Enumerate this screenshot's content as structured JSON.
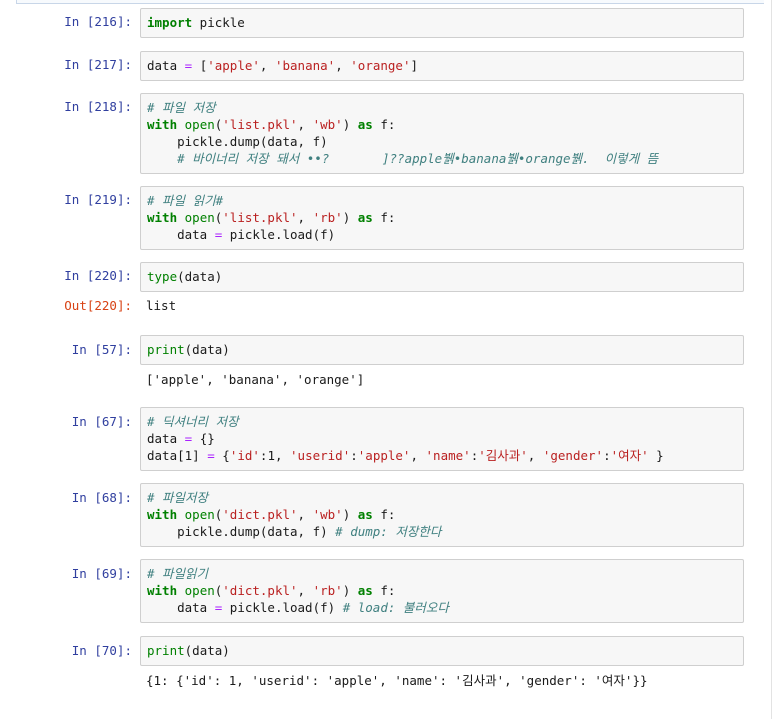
{
  "cells": [
    {
      "prompt": "In [216]:",
      "lines": [
        [
          "kw",
          "import"
        ],
        [
          "plain",
          " pickle"
        ]
      ]
    },
    {
      "prompt": "In [217]:",
      "code": "data = ['apple', 'banana', 'orange']"
    },
    {
      "prompt": "In [218]:",
      "code_lines": [
        "# 파일 저장",
        "with open('list.pkl', 'wb') as f:",
        "    pickle.dump(data, f)",
        "    # 바이너리 저장 돼서 ••?       ]??apple뷁•banana뷁•orange뷁.  이렇게 뜸"
      ]
    },
    {
      "prompt": "In [219]:",
      "code_lines": [
        "# 파일 읽기#",
        "with open('list.pkl', 'rb') as f:",
        "    data = pickle.load(f)"
      ]
    },
    {
      "prompt": "In [220]:",
      "code": "type(data)",
      "out_prompt": "Out[220]:",
      "output": "list"
    },
    {
      "prompt": "In [57]:",
      "code": "print(data)",
      "output": "['apple', 'banana', 'orange']"
    },
    {
      "prompt": "In [67]:",
      "code_lines": [
        "# 딕셔너리 저장",
        "data = {}",
        "data[1] = {'id':1, 'userid':'apple', 'name':'김사과', 'gender':'여자' }"
      ]
    },
    {
      "prompt": "In [68]:",
      "code_lines": [
        "# 파일저장",
        "with open('dict.pkl', 'wb') as f:",
        "    pickle.dump(data, f) # dump: 저장한다"
      ]
    },
    {
      "prompt": "In [69]:",
      "code_lines": [
        "# 파일읽기",
        "with open('dict.pkl', 'rb') as f:",
        "    data = pickle.load(f) # load: 불러오다"
      ]
    },
    {
      "prompt": "In [70]:",
      "code": "print(data)",
      "output": "{1: {'id': 1, 'userid': 'apple', 'name': '김사과', 'gender': '여자'}}"
    }
  ]
}
